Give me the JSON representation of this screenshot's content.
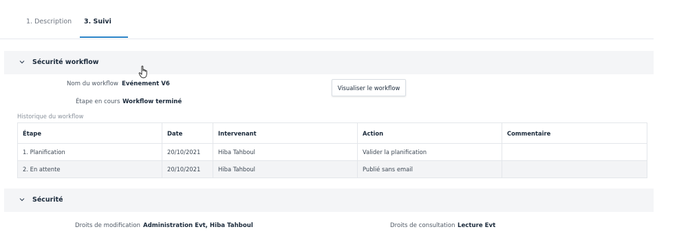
{
  "tabs": [
    {
      "label": "1. Description",
      "active": false
    },
    {
      "label": "3. Suivi",
      "active": true
    }
  ],
  "accent_color": "#2a83c7",
  "security_workflow": {
    "title": "Sécurité workflow",
    "workflow_name_label": "Nom du workflow",
    "workflow_name_value": "Evénement V6",
    "current_step_label": "Étape en cours",
    "current_step_value": "Workflow terminé",
    "visualize_button": "Visualiser le workflow",
    "history_label": "Historique du workflow",
    "history": {
      "columns": [
        "Étape",
        "Date",
        "Intervenant",
        "Action",
        "Commentaire"
      ],
      "rows": [
        [
          "1. Planification",
          "20/10/2021",
          "Hiba Tahboul",
          "Valider la planification",
          ""
        ],
        [
          "2. En attente",
          "20/10/2021",
          "Hiba Tahboul",
          "Publié sans email",
          ""
        ]
      ]
    }
  },
  "security": {
    "title": "Sécurité",
    "edit_rights_label": "Droits de modification",
    "edit_rights_value": "Administration Evt, Hiba Tahboul",
    "view_rights_label": "Droits de consultation",
    "view_rights_value": "Lecture Evt"
  },
  "icons": {
    "collapse": "chevron-down-icon",
    "cursor": "hand-pointer-icon"
  }
}
